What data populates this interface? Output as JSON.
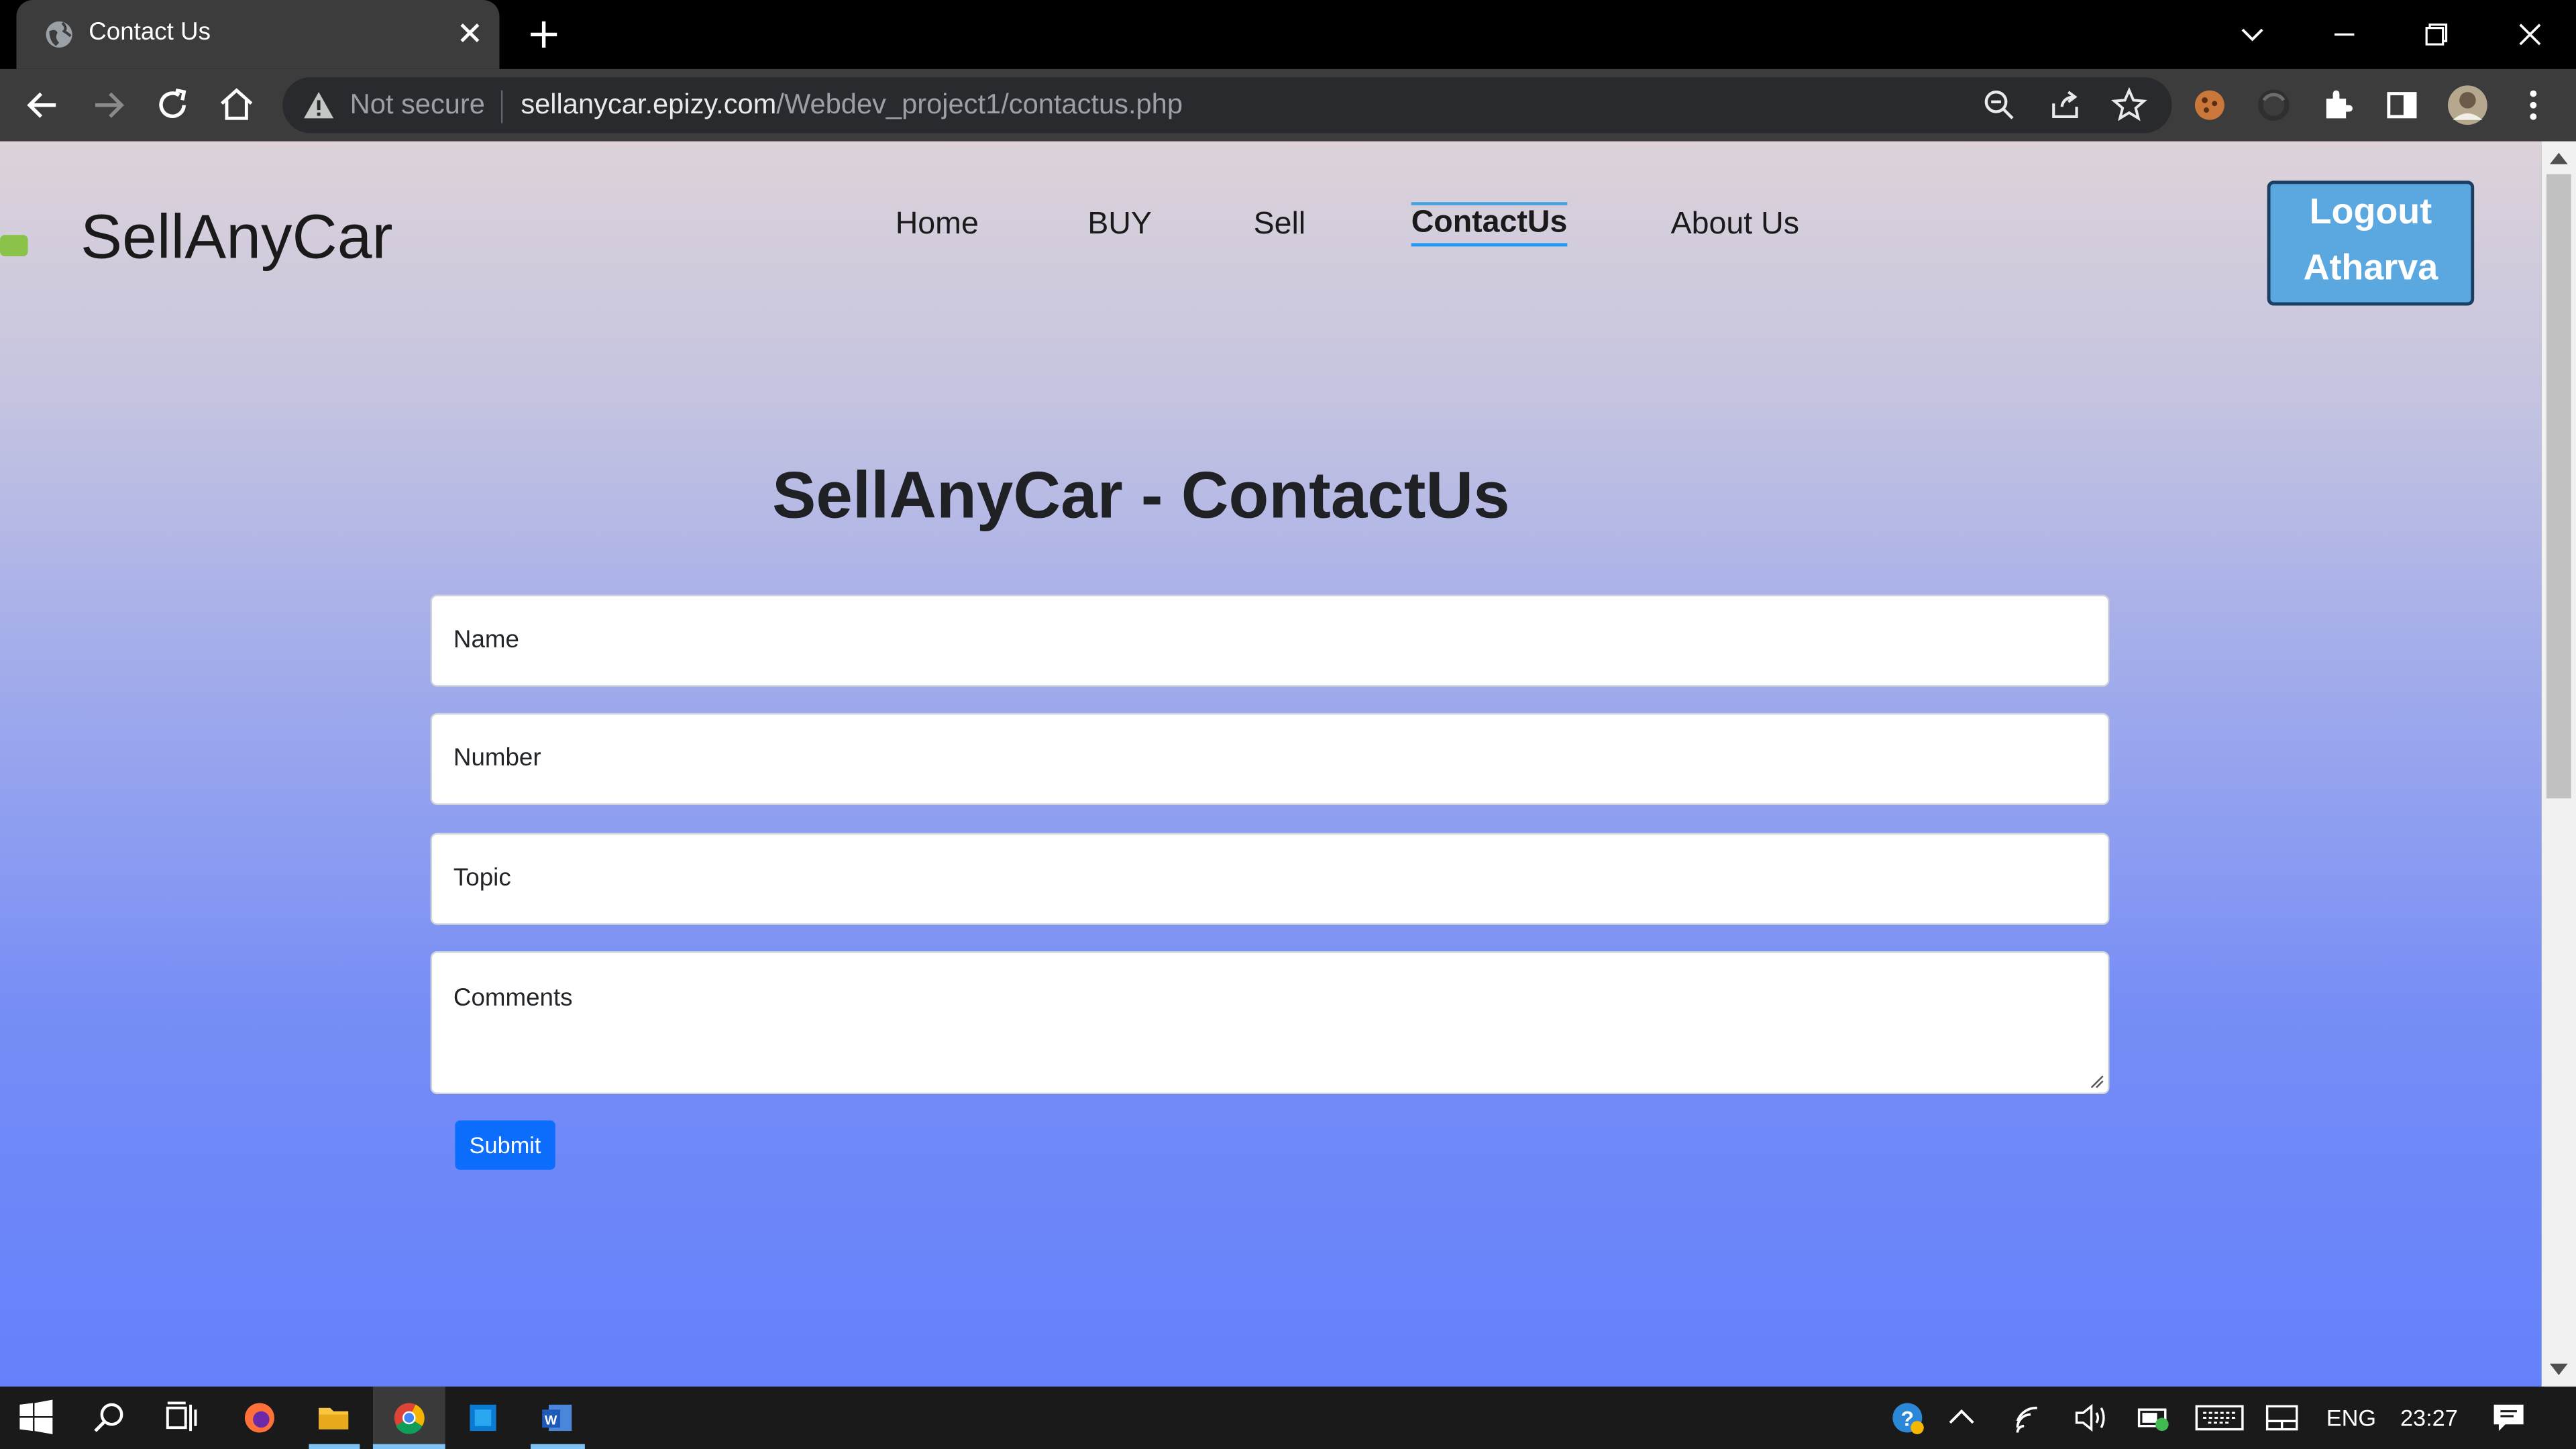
{
  "browser": {
    "tab_title": "Contact Us",
    "security_label": "Not secure",
    "url_host": "sellanycar.epizy.com",
    "url_path": "/Webdev_project1/contactus.php"
  },
  "site": {
    "brand": "SellAnyCar",
    "nav": [
      {
        "label": "Home",
        "active": false
      },
      {
        "label": "BUY",
        "active": false
      },
      {
        "label": "Sell",
        "active": false
      },
      {
        "label": "ContactUs",
        "active": true
      },
      {
        "label": "About Us",
        "active": false
      }
    ],
    "logout_line1": "Logout",
    "logout_line2": "Atharva"
  },
  "form": {
    "heading": "SellAnyCar - ContactUs",
    "name_placeholder": "Name",
    "number_placeholder": "Number",
    "topic_placeholder": "Topic",
    "comments_placeholder": "Comments",
    "submit_label": "Submit"
  },
  "taskbar": {
    "language": "ENG",
    "time": "23:27"
  },
  "colors": {
    "accent": "#0d6efd",
    "logout_bg": "#5ba8e0",
    "gradient_top": "#ddd2d9",
    "gradient_bottom": "#6481fb"
  }
}
